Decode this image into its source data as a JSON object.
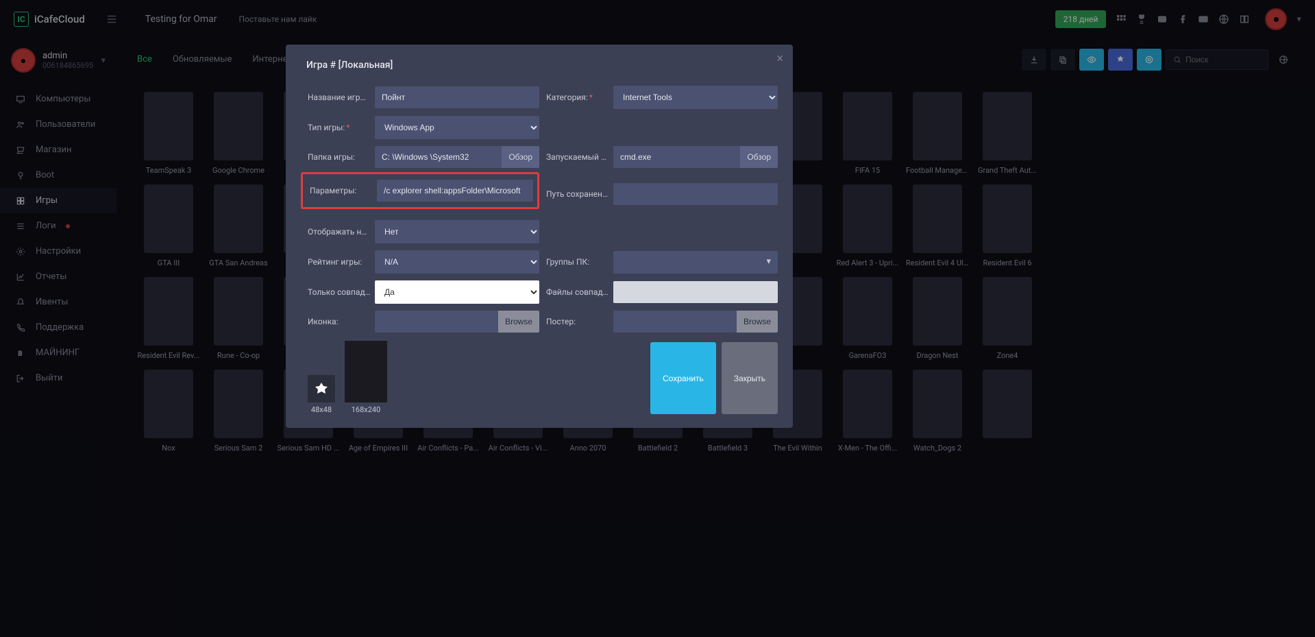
{
  "header": {
    "logo": "iCafeCloud",
    "site": "Testing for Omar",
    "like": "Поставьте нам лайк",
    "days": "218 дней",
    "search_placeholder": "Поиск"
  },
  "user": {
    "name": "admin",
    "sub": "006184865695"
  },
  "nav": [
    {
      "icon": "monitor",
      "label": "Компьютеры"
    },
    {
      "icon": "people",
      "label": "Пользователи"
    },
    {
      "icon": "cart",
      "label": "Магазин"
    },
    {
      "icon": "bulb",
      "label": "Boot"
    },
    {
      "icon": "plus",
      "label": "Игры",
      "active": true
    },
    {
      "icon": "list",
      "label": "Логи",
      "dot": true
    },
    {
      "icon": "gear",
      "label": "Настройки"
    },
    {
      "icon": "chart",
      "label": "Отчеты"
    },
    {
      "icon": "bell",
      "label": "Ивенты"
    },
    {
      "icon": "phone",
      "label": "Поддержка"
    },
    {
      "icon": "bitcoin",
      "label": "МАЙНИНГ"
    },
    {
      "icon": "logout",
      "label": "Выйти"
    }
  ],
  "tabs": {
    "items": [
      "Все",
      "Обновляемые",
      "Интернет"
    ],
    "active": 0,
    "search_placeholder": "Поиск"
  },
  "games_row1": [
    "TeamSpeak 3",
    "Google Chrome",
    "",
    "",
    "",
    "",
    "",
    "",
    "",
    "",
    "FIFA 15",
    "Football Manager...",
    "Grand Theft Aut..."
  ],
  "games_row2": [
    "GTA III",
    "GTA San Andreas",
    "",
    "",
    "",
    "",
    "",
    "",
    "",
    "",
    "Red Alert 3 - Upri...",
    "Resident Evil 4 Ul...",
    "Resident Evil 6"
  ],
  "games_row3": [
    "Resident Evil Rev...",
    "Rune - Co-op",
    "",
    "",
    "",
    "",
    "",
    "",
    "",
    "",
    "GarenaFO3",
    "Dragon Nest",
    "Zone4"
  ],
  "games_row4": [
    "Nox",
    "Serious Sam 2",
    "Serious Sam HD ...",
    "Age of Empires III",
    "Air Conflicts - Pa...",
    "Air Conflicts - Vi...",
    "Anno 2070",
    "Battlefield 2",
    "Battlefield 3",
    "The Evil Within",
    "X-Men - The Offi...",
    "Watch_Dogs 2",
    ""
  ],
  "modal": {
    "title": "Игра # [Локальная]",
    "labels": {
      "name": "Название игры:",
      "category": "Категория:",
      "type": "Тип игры:",
      "folder": "Папка игры:",
      "exe": "Запускаемый файл...",
      "params": "Параметры:",
      "savepath": "Путь сохранений:",
      "taskbar": "Отображать на пан...",
      "rating": "Рейтинг игры:",
      "groups": "Группы ПК:",
      "matchonly": "Только совпадение:",
      "matchfiles": "Файлы совпадения:",
      "icon": "Иконка:",
      "poster": "Постер:"
    },
    "values": {
      "name": "Пойнт",
      "category": "Internet Tools",
      "type": "Windows App",
      "folder": "C: \\Windows \\System32",
      "exe": "cmd.exe",
      "params": "/c explorer shell:appsFolder\\Microsoft",
      "savepath": "",
      "taskbar": "Нет",
      "rating": "N/A",
      "matchonly": "Да",
      "matchfiles": ""
    },
    "browse": "Обзор",
    "browse_en": "Browse",
    "thumbs": {
      "small": "48x48",
      "large": "168x240"
    },
    "save": "Сохранить",
    "close": "Закрыть"
  }
}
